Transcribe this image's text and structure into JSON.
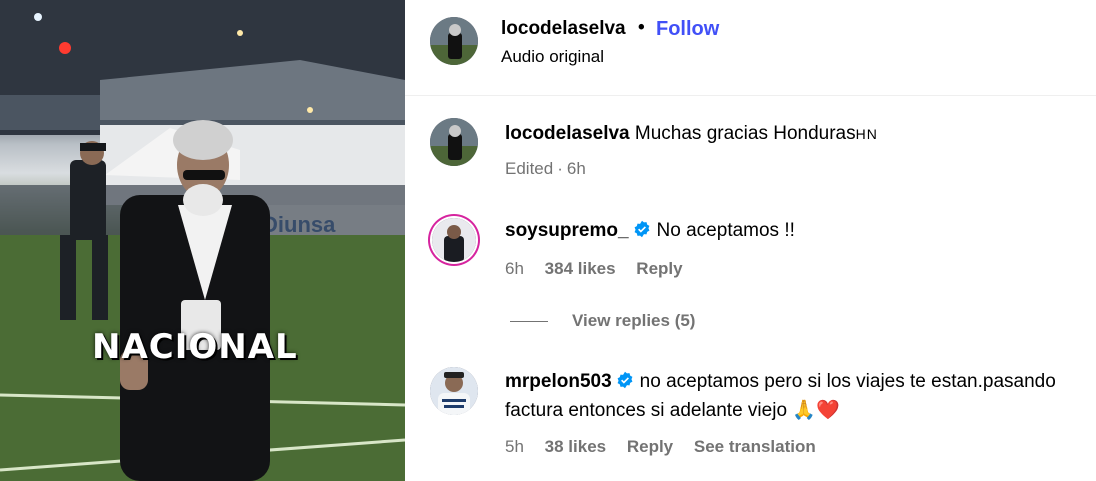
{
  "post": {
    "overlay_text": "NACIONAL"
  },
  "header": {
    "username": "locodelaselva",
    "separator": "•",
    "follow_label": "Follow",
    "audio_label": "Audio original"
  },
  "comments": [
    {
      "username": "locodelaselva",
      "text": "Muchas gracias Honduras🇭🇳",
      "flag_label": "HN",
      "meta_edited": "Edited",
      "meta_dot": "·",
      "time": "6h"
    },
    {
      "username": "soysupremo_",
      "verified": true,
      "text": "No aceptamos !!",
      "time": "6h",
      "likes": "384 likes",
      "reply_label": "Reply"
    },
    {
      "username": "mrpelon503",
      "verified": true,
      "text": "no aceptamos pero si los viajes te estan.pasando factura entonces si adelante viejo",
      "emojis": "🙏❤️",
      "time": "5h",
      "likes": "38 likes",
      "reply_label": "Reply",
      "translate_label": "See translation"
    }
  ],
  "view_replies_label": "View replies (5)",
  "colors": {
    "follow": "#4150f7",
    "muted": "#737373",
    "verified": "#0095f6"
  }
}
